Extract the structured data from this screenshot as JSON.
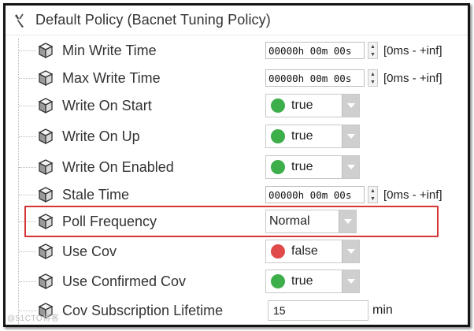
{
  "header": {
    "title": "Default Policy  (Bacnet Tuning Policy)",
    "icon": "wrench-icon"
  },
  "rows": [
    {
      "label": "Min Write Time",
      "type": "time",
      "value": "00000h 00m 00s",
      "range": "[0ms - +inf]"
    },
    {
      "label": "Max Write Time",
      "type": "time",
      "value": "00000h 00m 00s",
      "range": "[0ms - +inf]"
    },
    {
      "label": "Write On Start",
      "type": "bool",
      "value": "true",
      "color": "#3cae4a"
    },
    {
      "label": "Write On Up",
      "type": "bool",
      "value": "true",
      "color": "#3cae4a"
    },
    {
      "label": "Write On Enabled",
      "type": "bool",
      "value": "true",
      "color": "#3cae4a"
    },
    {
      "label": "Stale Time",
      "type": "time",
      "value": "00000h 00m 00s",
      "range": "[0ms - +inf]"
    },
    {
      "label": "Poll Frequency",
      "type": "select",
      "value": "Normal",
      "highlighted": true
    },
    {
      "label": "Use Cov",
      "type": "bool",
      "value": "false",
      "color": "#e04a4a"
    },
    {
      "label": "Use Confirmed Cov",
      "type": "bool",
      "value": "true",
      "color": "#3cae4a"
    },
    {
      "label": "Cov Subscription Lifetime",
      "type": "number",
      "value": "15",
      "unit": "min"
    }
  ],
  "highlight_color": "#d43535",
  "watermark": "@51CTO博客"
}
